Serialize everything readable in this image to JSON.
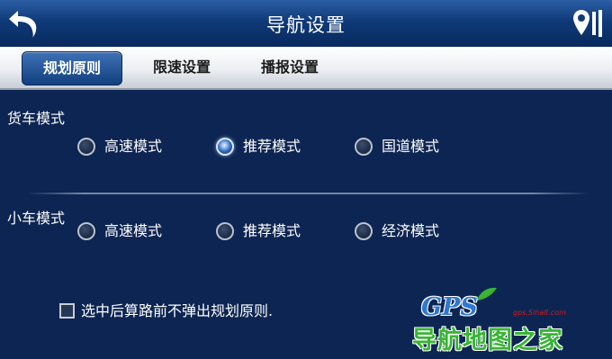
{
  "header": {
    "title": "导航设置",
    "back_icon": "back-arrow-icon",
    "map_icon": "map-pin-icon"
  },
  "tabs": [
    {
      "label": "规划原则",
      "active": true
    },
    {
      "label": "限速设置",
      "active": false
    },
    {
      "label": "播报设置",
      "active": false
    }
  ],
  "truck": {
    "label": "货车模式",
    "options": [
      {
        "label": "高速模式",
        "checked": false
      },
      {
        "label": "推荐模式",
        "checked": true
      },
      {
        "label": "国道模式",
        "checked": false
      }
    ]
  },
  "car": {
    "label": "小车模式",
    "options": [
      {
        "label": "高速模式",
        "checked": false
      },
      {
        "label": "推荐模式",
        "checked": false
      },
      {
        "label": "经济模式",
        "checked": false
      }
    ]
  },
  "confirm_checkbox": {
    "label": "选中后算路前不弹出规划原则.",
    "checked": false
  },
  "watermark": {
    "logo": "GPS",
    "url": "gps.5iha8.com",
    "name": "导航地图之家"
  },
  "colors": {
    "background": "#0d2552",
    "titlebar": "#0f3a78",
    "accent": "#2c64b8",
    "watermark_green": "#38b534",
    "watermark_blue": "#2f78d0"
  }
}
